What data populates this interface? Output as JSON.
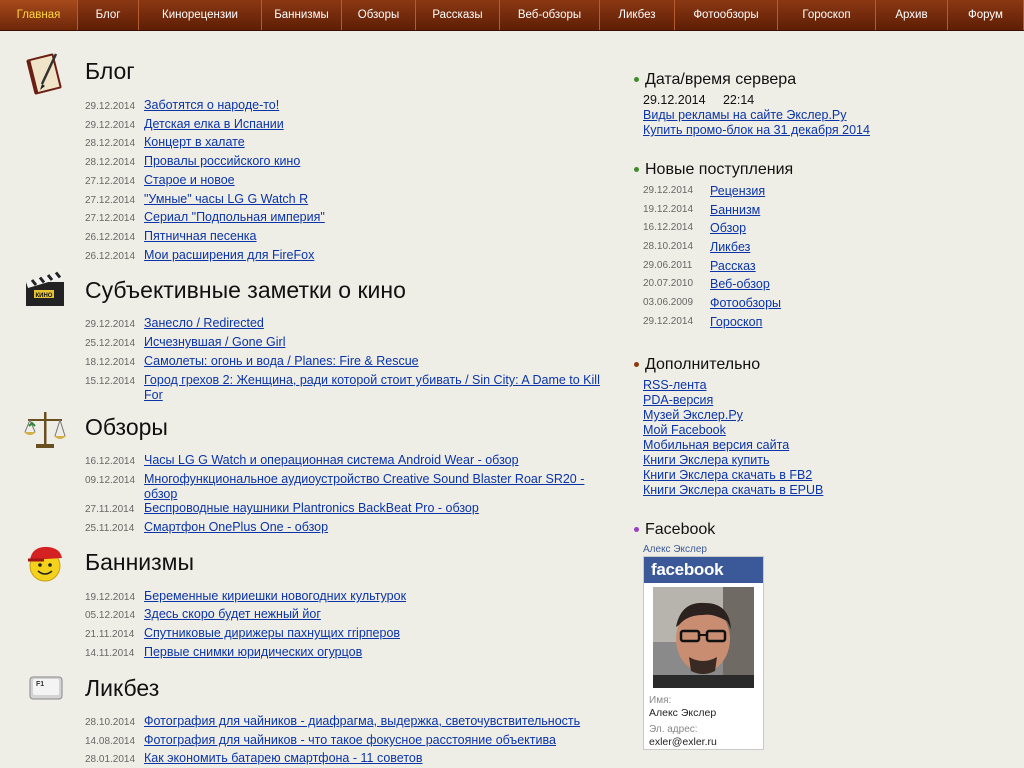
{
  "nav": {
    "items": [
      {
        "label": "Главная",
        "w": 78
      },
      {
        "label": "Блог",
        "w": 61
      },
      {
        "label": "Кинорецензии",
        "w": 123
      },
      {
        "label": "Баннизмы",
        "w": 80
      },
      {
        "label": "Обзоры",
        "w": 74
      },
      {
        "label": "Рассказы",
        "w": 84
      },
      {
        "label": "Веб-обзоры",
        "w": 100
      },
      {
        "label": "Ликбез",
        "w": 75
      },
      {
        "label": "Фотообзоры",
        "w": 103
      },
      {
        "label": "Гороскоп",
        "w": 98
      },
      {
        "label": "Архив",
        "w": 72
      },
      {
        "label": "Форум",
        "w": 76
      }
    ]
  },
  "sections": [
    {
      "title": "Блог",
      "icon": "book-pen-icon",
      "items": [
        {
          "date": "29.12.2014",
          "text": "Заботятся о народе-то!"
        },
        {
          "date": "29.12.2014",
          "text": "Детская елка в Испании"
        },
        {
          "date": "28.12.2014",
          "text": "Концерт в халате"
        },
        {
          "date": "28.12.2014",
          "text": "Провалы российского кино"
        },
        {
          "date": "27.12.2014",
          "text": "Старое и новое"
        },
        {
          "date": "27.12.2014",
          "text": "\"Умные\" часы LG G Watch R"
        },
        {
          "date": "27.12.2014",
          "text": "Сериал \"Подпольная империя\""
        },
        {
          "date": "26.12.2014",
          "text": "Пятничная песенка"
        },
        {
          "date": "26.12.2014",
          "text": "Мои расширения для FireFox"
        }
      ]
    },
    {
      "title": "Субъективные заметки о кино",
      "icon": "clapperboard-icon",
      "badge": "КИНО",
      "items": [
        {
          "date": "29.12.2014",
          "text": "Занесло / Redirected"
        },
        {
          "date": "25.12.2014",
          "text": "Исчезнувшая / Gone Girl"
        },
        {
          "date": "18.12.2014",
          "text": "Самолеты: огонь и вода / Planes: Fire & Rescue"
        },
        {
          "date": "15.12.2014",
          "text": "Город грехов 2: Женщина, ради которой стоит убивать / Sin City: A Dame to Kill For"
        }
      ]
    },
    {
      "title": "Обзоры",
      "icon": "scales-icon",
      "items": [
        {
          "date": "16.12.2014",
          "text": "Часы LG G Watch и операционная система Android Wear - обзор"
        },
        {
          "date": "09.12.2014",
          "text": "Многофункциональное аудиоустройство Creative Sound Blaster Roar SR20 - обзор"
        },
        {
          "date": "27.11.2014",
          "text": "Беспроводные наушники Plantronics BackBeat Pro - обзор"
        },
        {
          "date": "25.11.2014",
          "text": "Смартфон OnePlus One - обзор"
        }
      ]
    },
    {
      "title": "Баннизмы",
      "icon": "smiley-cap-icon",
      "items": [
        {
          "date": "19.12.2014",
          "text": "Беременные кириешки новогодних культурок"
        },
        {
          "date": "05.12.2014",
          "text": "Здесь скоро будет нежный йог"
        },
        {
          "date": "21.11.2014",
          "text": "Спутниковые дирижеры пахнущих гripперов"
        },
        {
          "date": "14.11.2014",
          "text": "Первые снимки юридических огурцов"
        }
      ]
    },
    {
      "title": "Ликбез",
      "icon": "f1-key-icon",
      "badge": "F1",
      "items": [
        {
          "date": "28.10.2014",
          "text": "Фотография для чайников - диафрагма, выдержка, светочувствительность"
        },
        {
          "date": "14.08.2014",
          "text": "Фотография для чайников - что такое фокусное расстояние объектива"
        },
        {
          "date": "28.01.2014",
          "text": "Как экономить батарею смартфона - 11 советов"
        }
      ]
    }
  ],
  "right": {
    "server": {
      "title": "Дата/время сервера",
      "date": "29.12.2014",
      "time": "22:14",
      "links": [
        "Виды рекламы на сайте Экслер.Ру",
        "Купить промо-блок на 31 декабря 2014"
      ]
    },
    "new": {
      "title": "Новые поступления",
      "items": [
        {
          "date": "29.12.2014",
          "text": "Рецензия"
        },
        {
          "date": "19.12.2014",
          "text": "Баннизм"
        },
        {
          "date": "16.12.2014",
          "text": "Обзор"
        },
        {
          "date": "28.10.2014",
          "text": "Ликбез"
        },
        {
          "date": "29.06.2011",
          "text": "Рассказ"
        },
        {
          "date": "20.07.2010",
          "text": "Веб-обзор"
        },
        {
          "date": "03.06.2009",
          "text": "Фотообзоры"
        },
        {
          "date": "29.12.2014",
          "text": "Гороскоп"
        }
      ]
    },
    "extra": {
      "title": "Дополнительно",
      "links": [
        "RSS-лента",
        "PDA-версия",
        "Музей Экслер.Ру",
        "Мой Facebook",
        "Мобильная версия сайта",
        "Книги Экслера купить",
        "Книги Экслера скачать в FB2",
        "Книги Экслера скачать в EPUB"
      ]
    },
    "facebook": {
      "title": "Facebook",
      "profile_link": "Алекс Экслер",
      "logo": "facebook",
      "name_label": "Имя:",
      "name": "Алекс Экслер",
      "email_label": "Эл. адрес:",
      "email": "exler@exler.ru"
    },
    "colors": {
      "bullet_green": "#3c8d2c",
      "bullet_brown": "#8c3b0f",
      "bullet_purple": "#9b3fbf",
      "nav": "#6e2708",
      "link": "#0b34a8"
    }
  }
}
